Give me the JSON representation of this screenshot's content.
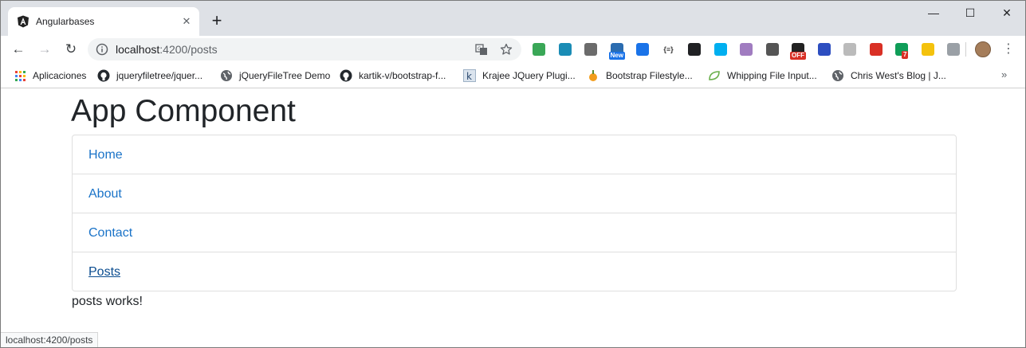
{
  "browser": {
    "tab": {
      "title": "Angularbases",
      "close_glyph": "✕"
    },
    "new_tab_glyph": "+",
    "window_controls": {
      "minimize": "—",
      "maximize": "☐",
      "close": "✕"
    },
    "address": {
      "host": "localhost",
      "path": ":4200/posts"
    },
    "nav": {
      "back": "←",
      "forward": "→",
      "reload": "↻"
    },
    "extensions": [
      {
        "name": "ext-green-j-icon",
        "color": "#3aa757"
      },
      {
        "name": "ext-spiral-icon",
        "color": "#1a8cb5"
      },
      {
        "name": "ext-magnifier-icon",
        "color": "#6b6b6b"
      },
      {
        "name": "ext-window-new-icon",
        "color": "#2b6cb0",
        "badge": "New"
      },
      {
        "name": "ext-check-icon",
        "color": "#1a73e8"
      },
      {
        "name": "ext-json-icon",
        "color": "#333333",
        "glyph": "{≡}"
      },
      {
        "name": "ext-terminal-icon",
        "color": "#202124"
      },
      {
        "name": "ext-skype-icon",
        "color": "#00aff0"
      },
      {
        "name": "ext-grid-icon",
        "color": "#a07cc0"
      },
      {
        "name": "ext-circle-icon",
        "color": "#555555"
      },
      {
        "name": "ext-off-icon",
        "color": "#222222",
        "badge": "OFF"
      },
      {
        "name": "ext-moon-icon",
        "color": "#2d4ec0"
      },
      {
        "name": "ext-refresh-icon",
        "color": "#bbbbbb"
      },
      {
        "name": "ext-pdf-icon",
        "color": "#d93025"
      },
      {
        "name": "ext-a-icon",
        "color": "#0f9d58",
        "badge": "7"
      },
      {
        "name": "ext-yellow-search-icon",
        "color": "#f4c20d"
      },
      {
        "name": "ext-code-icon",
        "color": "#9aa0a6"
      }
    ],
    "bookmarks": [
      {
        "label": "Aplicaciones",
        "icon": "apps-grid-icon"
      },
      {
        "label": "jqueryfiletree/jquer...",
        "icon": "github-icon"
      },
      {
        "label": "jQueryFileTree Demo",
        "icon": "globe-icon"
      },
      {
        "label": "kartik-v/bootstrap-f...",
        "icon": "github-icon"
      },
      {
        "label": "Krajee JQuery Plugi...",
        "icon": "krajee-k-icon"
      },
      {
        "label": "Bootstrap Filestyle...",
        "icon": "bootstrap-filestyle-icon"
      },
      {
        "label": "Whipping File Input...",
        "icon": "leaf-icon"
      },
      {
        "label": "Chris West's Blog | J...",
        "icon": "globe-icon"
      }
    ],
    "bookmarks_more": "»",
    "status_url": "localhost:4200/posts"
  },
  "page": {
    "title": "App Component",
    "nav": [
      {
        "label": "Home",
        "active": false
      },
      {
        "label": "About",
        "active": false
      },
      {
        "label": "Contact",
        "active": false
      },
      {
        "label": "Posts",
        "active": true
      }
    ],
    "content": "posts works!"
  },
  "colors": {
    "link": "#1a73c8",
    "link_active": "#0a4c8f",
    "tabstrip": "#dee1e6"
  }
}
